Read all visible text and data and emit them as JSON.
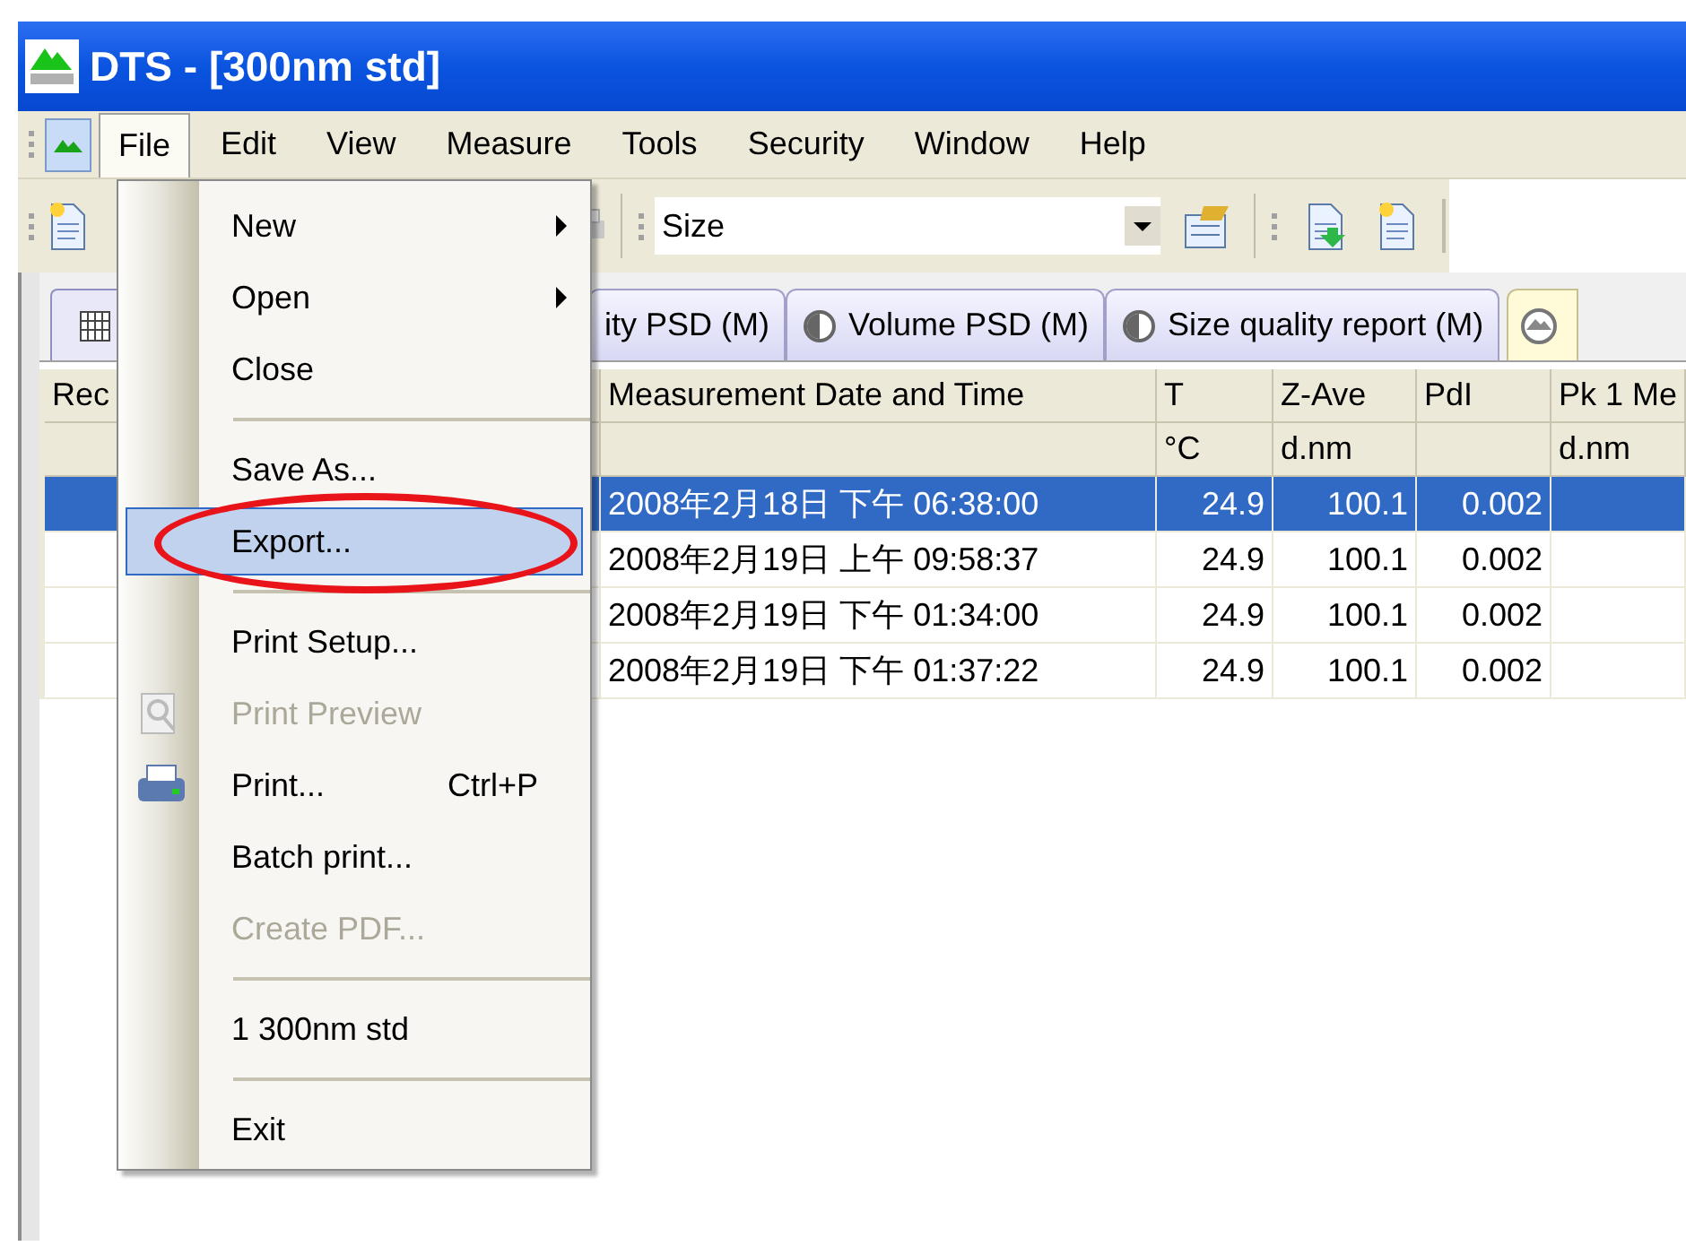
{
  "window": {
    "title": "DTS - [300nm std]"
  },
  "menu_bar": [
    {
      "label": "File",
      "selected": true
    },
    {
      "label": "Edit",
      "selected": false
    },
    {
      "label": "View",
      "selected": false
    },
    {
      "label": "Measure",
      "selected": false
    },
    {
      "label": "Tools",
      "selected": false
    },
    {
      "label": "Security",
      "selected": false
    },
    {
      "label": "Window",
      "selected": false
    },
    {
      "label": "Help",
      "selected": false
    }
  ],
  "toolbar": {
    "combo": {
      "value": "Size"
    }
  },
  "tabs": [
    {
      "label": "ity PSD (M)",
      "selected": false
    },
    {
      "label": "Volume PSD (M)",
      "selected": false
    },
    {
      "label": "Size quality report (M)",
      "selected": false
    }
  ],
  "table": {
    "columns": [
      {
        "label": "Rec"
      },
      {
        "label": "Measurement Date and Time"
      },
      {
        "label": "T",
        "unit": "°C"
      },
      {
        "label": "Z-Ave",
        "unit": "d.nm"
      },
      {
        "label": "PdI"
      },
      {
        "label": "Pk 1 Me",
        "unit": "d.nm"
      }
    ],
    "rows": [
      {
        "selected": true,
        "cells": [
          "",
          "2008年2月18日 下午 06:38:00",
          "24.9",
          "100.1",
          "0.002",
          ""
        ]
      },
      {
        "selected": false,
        "cells": [
          "",
          "2008年2月19日 上午 09:58:37",
          "24.9",
          "100.1",
          "0.002",
          ""
        ]
      },
      {
        "selected": false,
        "cells": [
          "",
          "2008年2月19日 下午 01:34:00",
          "24.9",
          "100.1",
          "0.002",
          ""
        ]
      },
      {
        "selected": false,
        "cells": [
          "",
          "2008年2月19日 下午 01:37:22",
          "24.9",
          "100.1",
          "0.002",
          ""
        ]
      }
    ]
  },
  "file_menu": [
    {
      "kind": "item",
      "label": "New",
      "submenu": true,
      "disabled": false,
      "selected": false
    },
    {
      "kind": "item",
      "label": "Open",
      "submenu": true,
      "disabled": false,
      "selected": false
    },
    {
      "kind": "item",
      "label": "Close",
      "submenu": false,
      "disabled": false,
      "selected": false
    },
    {
      "kind": "separator"
    },
    {
      "kind": "item",
      "label": "Save As...",
      "submenu": false,
      "disabled": false,
      "selected": false
    },
    {
      "kind": "item",
      "label": "Export...",
      "submenu": false,
      "disabled": false,
      "selected": true
    },
    {
      "kind": "separator"
    },
    {
      "kind": "item",
      "label": "Print Setup...",
      "submenu": false,
      "disabled": false,
      "selected": false
    },
    {
      "kind": "item",
      "label": "Print Preview",
      "submenu": false,
      "disabled": true,
      "selected": false
    },
    {
      "kind": "item",
      "label": "Print...",
      "shortcut": "Ctrl+P",
      "submenu": false,
      "disabled": false,
      "selected": false
    },
    {
      "kind": "item",
      "label": "Batch print...",
      "submenu": false,
      "disabled": false,
      "selected": false
    },
    {
      "kind": "item",
      "label": "Create PDF...",
      "submenu": false,
      "disabled": true,
      "selected": false
    },
    {
      "kind": "separator"
    },
    {
      "kind": "item",
      "label": "1 300nm std",
      "submenu": false,
      "disabled": false,
      "selected": false
    },
    {
      "kind": "separator"
    },
    {
      "kind": "item",
      "label": "Exit",
      "submenu": false,
      "disabled": false,
      "selected": false
    }
  ]
}
